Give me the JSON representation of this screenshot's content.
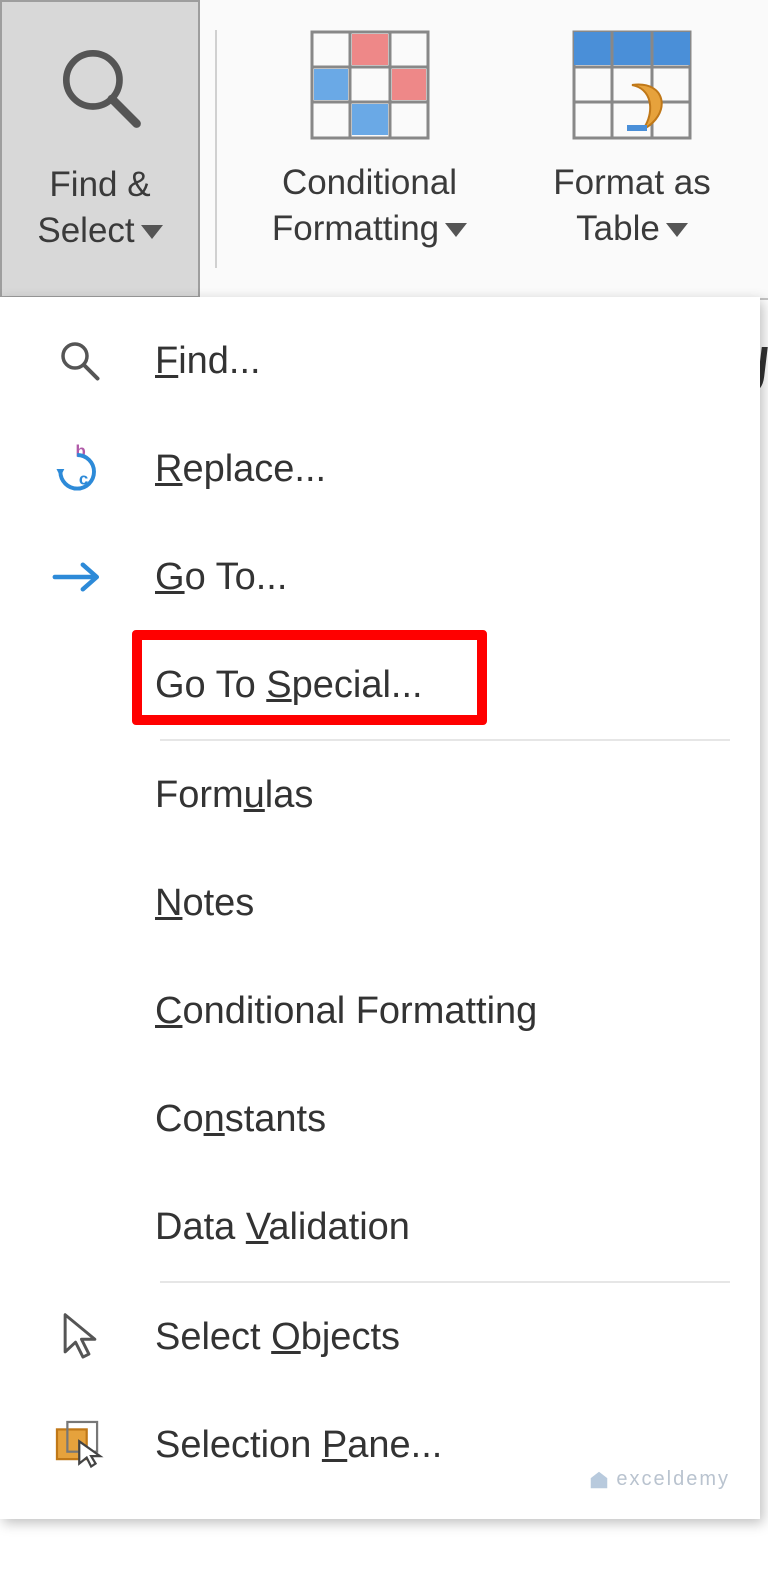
{
  "ribbon": {
    "find_select": {
      "line1": "Find &",
      "line2": "Select"
    },
    "conditional_formatting": {
      "line1": "Conditional",
      "line2": "Formatting"
    },
    "format_as_table": {
      "line1": "Format as",
      "line2": "Table"
    }
  },
  "menu": {
    "find": {
      "pre": "",
      "u": "F",
      "post": "ind..."
    },
    "replace": {
      "pre": "",
      "u": "R",
      "post": "eplace..."
    },
    "goto": {
      "pre": "",
      "u": "G",
      "post": "o To..."
    },
    "gotospecial": {
      "pre": "Go To ",
      "u": "S",
      "post": "pecial..."
    },
    "formulas": {
      "pre": "Form",
      "u": "u",
      "post": "las"
    },
    "notes": {
      "pre": "",
      "u": "N",
      "post": "otes"
    },
    "cond": {
      "pre": "",
      "u": "C",
      "post": "onditional Formatting"
    },
    "constants": {
      "pre": "Co",
      "u": "n",
      "post": "stants"
    },
    "datavalid": {
      "pre": "Data ",
      "u": "V",
      "post": "alidation"
    },
    "selobj": {
      "pre": "Select ",
      "u": "O",
      "post": "bjects"
    },
    "selpane": {
      "pre": "Selection ",
      "u": "P",
      "post": "ane..."
    }
  },
  "side_char": "J",
  "watermark": "exceldemy"
}
